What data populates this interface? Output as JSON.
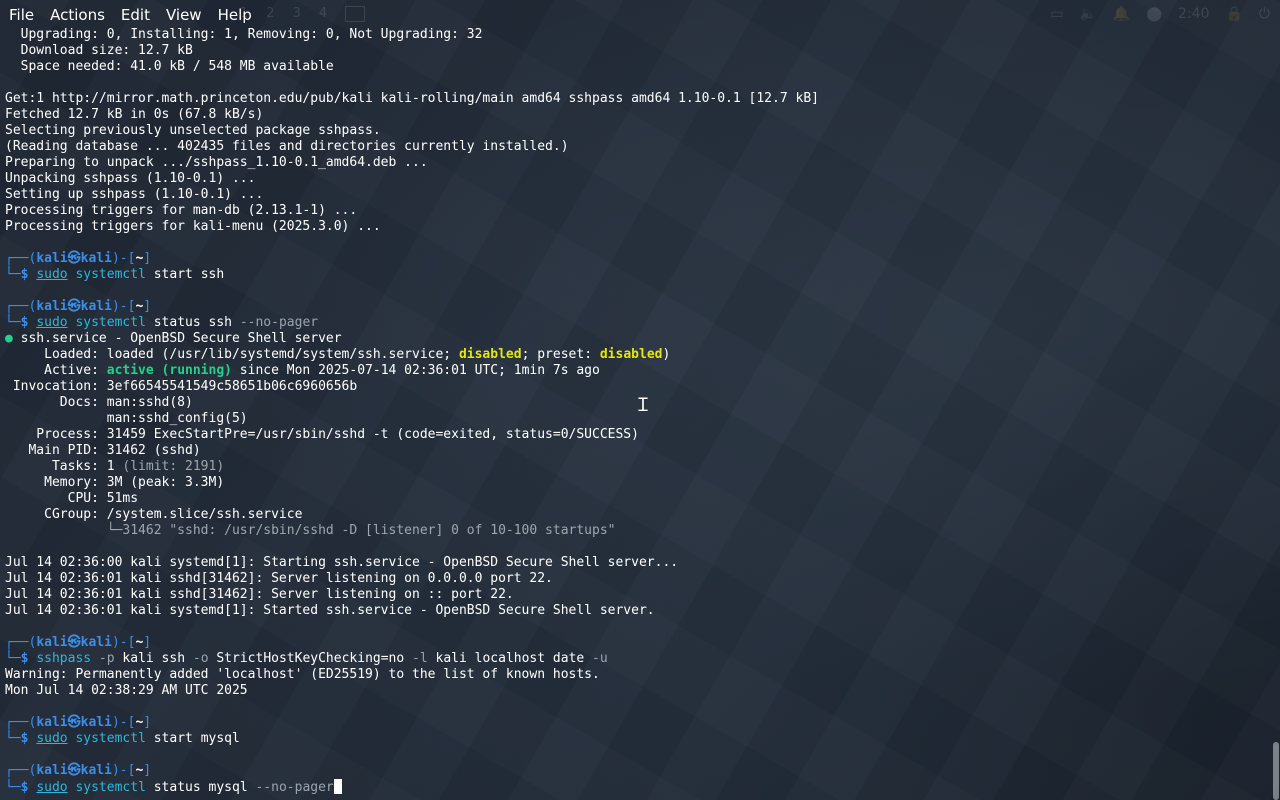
{
  "menu": [
    "File",
    "Actions",
    "Edit",
    "View",
    "Help"
  ],
  "workspaces": [
    "1",
    "2",
    "3",
    "4"
  ],
  "clock": "2:40",
  "output_top": [
    "  Upgrading: 0, Installing: 1, Removing: 0, Not Upgrading: 32",
    "  Download size: 12.7 kB",
    "  Space needed: 41.0 kB / 548 MB available",
    "",
    "Get:1 http://mirror.math.princeton.edu/pub/kali kali-rolling/main amd64 sshpass amd64 1.10-0.1 [12.7 kB]",
    "Fetched 12.7 kB in 0s (67.8 kB/s)",
    "Selecting previously unselected package sshpass.",
    "(Reading database ... 402435 files and directories currently installed.)",
    "Preparing to unpack .../sshpass_1.10-0.1_amd64.deb ...",
    "Unpacking sshpass (1.10-0.1) ...",
    "Setting up sshpass (1.10-0.1) ...",
    "Processing triggers for man-db (2.13.1-1) ...",
    "Processing triggers for kali-menu (2025.3.0) ..."
  ],
  "prompt": {
    "top_left": "┌──(",
    "user": "kali",
    "at": "㉿",
    "host": "kali",
    "mid": ")-[",
    "dir": "~",
    "end": "]",
    "bottom": "└─",
    "dollar": "$ "
  },
  "cmd1": {
    "sudo": "sudo",
    "name": "systemctl",
    "args": " start ssh"
  },
  "cmd2": {
    "sudo": "sudo",
    "name": "systemctl",
    "args": " status ssh ",
    "opt": "--no-pager"
  },
  "status": {
    "dot": "●",
    "title": " ssh.service - OpenBSD Secure Shell server",
    "loaded_label": "     Loaded: ",
    "loaded_pre": "loaded (/usr/lib/systemd/system/ssh.service; ",
    "loaded_disabled": "disabled",
    "loaded_mid": "; preset: ",
    "loaded_preset": "disabled",
    "loaded_post": ")",
    "active_label": "     Active: ",
    "active_state": "active (running)",
    "active_post": " since Mon 2025-07-14 02:36:01 UTC; 1min 7s ago",
    "invocation": " Invocation: 3ef66545541549c58651b06c6960656b",
    "docs1": "       Docs: man:sshd(8)",
    "docs2": "             man:sshd_config(5)",
    "process": "    Process: 31459 ExecStartPre=/usr/sbin/sshd -t (code=exited, status=0/SUCCESS)",
    "mainpid": "   Main PID: 31462 (sshd)",
    "tasks_label": "      Tasks: 1 ",
    "tasks_limit": "(limit: 2191)",
    "memory": "     Memory: 3M (peak: 3.3M)",
    "cpu": "        CPU: 51ms",
    "cgroup": "     CGroup: /system.slice/ssh.service",
    "cgroup_child": "             └─31462 \"sshd: /usr/sbin/sshd -D [listener] 0 of 10-100 startups\""
  },
  "journal": [
    "Jul 14 02:36:00 kali systemd[1]: Starting ssh.service - OpenBSD Secure Shell server...",
    "Jul 14 02:36:01 kali sshd[31462]: Server listening on 0.0.0.0 port 22.",
    "Jul 14 02:36:01 kali sshd[31462]: Server listening on :: port 22.",
    "Jul 14 02:36:01 kali systemd[1]: Started ssh.service - OpenBSD Secure Shell server."
  ],
  "cmd3": {
    "name": "sshpass",
    "p": " -p",
    "a1": " kali ssh",
    "o": " -o",
    "a2": " StrictHostKeyChecking=no",
    "l": " -l",
    "a3": " kali localhost date",
    "u": " -u"
  },
  "cmd3_out": [
    "Warning: Permanently added 'localhost' (ED25519) to the list of known hosts.",
    "Mon Jul 14 02:38:29 AM UTC 2025"
  ],
  "cmd4": {
    "sudo": "sudo",
    "name": "systemctl",
    "args": " start mysql"
  },
  "cmd5": {
    "sudo": "sudo",
    "name": "systemctl",
    "args": " status mysql ",
    "opt": "--no-pager"
  },
  "colors": {
    "prompt": "#3b8eea",
    "command": "#29b8db",
    "warning_word": "#e5e510",
    "running": "#23d18b"
  }
}
